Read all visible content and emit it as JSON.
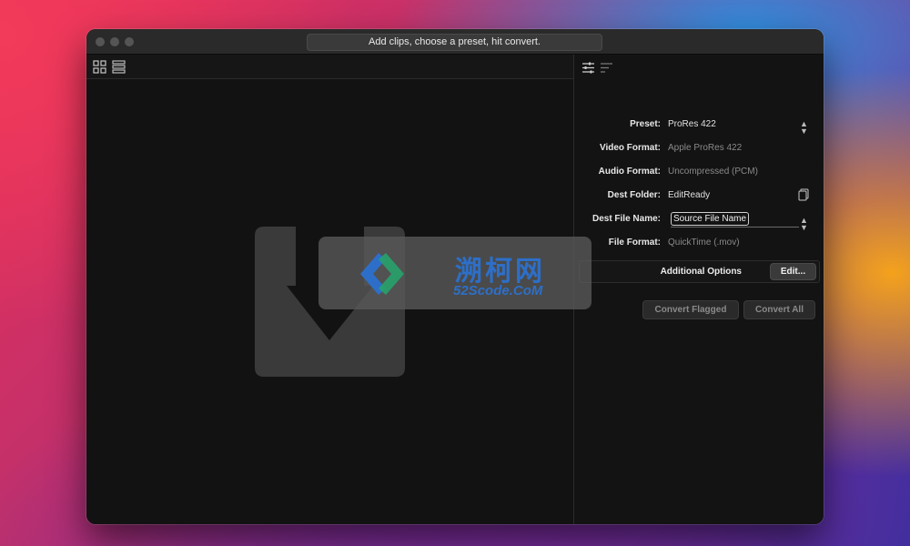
{
  "window": {
    "title": "Add clips, choose a preset, hit convert."
  },
  "left_toolbar": {
    "icons": [
      "grid-view-icon",
      "list-view-icon"
    ]
  },
  "drop_area": {
    "icon": "drop-arrow-icon"
  },
  "right_toolbar": {
    "icons": [
      "settings-sliders-icon",
      "sort-lines-icon"
    ]
  },
  "settings": {
    "preset": {
      "label": "Preset:",
      "value": "ProRes 422"
    },
    "video_format": {
      "label": "Video Format:",
      "value": "Apple ProRes 422"
    },
    "audio_format": {
      "label": "Audio Format:",
      "value": "Uncompressed (PCM)"
    },
    "dest_folder": {
      "label": "Dest Folder:",
      "value": "EditReady"
    },
    "dest_file_name": {
      "label": "Dest File Name:",
      "token": "Source File Name"
    },
    "file_format": {
      "label": "File Format:",
      "value": "QuickTime (.mov)"
    }
  },
  "additional_options": {
    "label": "Additional Options",
    "edit_button": "Edit..."
  },
  "actions": {
    "convert_flagged": "Convert Flagged",
    "convert_all": "Convert All"
  },
  "watermark": {
    "title": "溯柯网",
    "subtitle": "52Scode.CoM"
  },
  "colors": {
    "window_bg": "#131313",
    "titlebar_bg": "#2a2a2a",
    "watermark_blue": "#2d6fc8"
  }
}
